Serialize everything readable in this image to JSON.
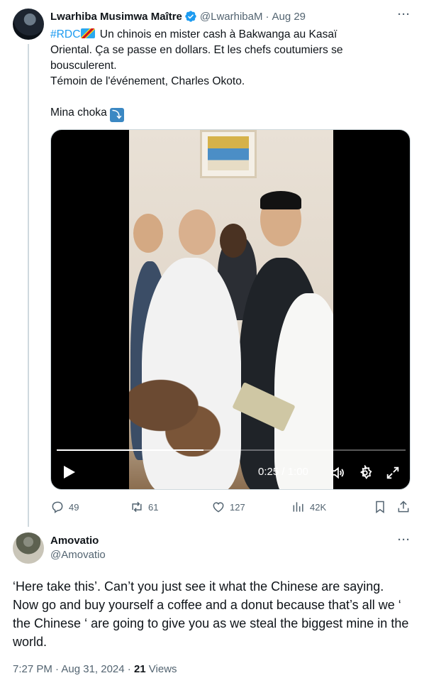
{
  "tweet": {
    "author_name": "Lwarhiba Musimwa Maître",
    "author_handle": "@LwarhibaM",
    "date": "Aug 29",
    "hashtag": "#RDC",
    "text_line1": " Un chinois en mister cash à Bakwanga au Kasaï",
    "text_line2": "Oriental. Ça se passe en dollars. Et les chefs coutumiers se",
    "text_line3": "bousculerent.",
    "text_line4": "Témoin de l'événement, Charles Okoto.",
    "text_line5": "Mina choka",
    "arrow_emoji": "⤵",
    "video": {
      "time": "0:25 / 1:00",
      "progress_fraction": 0.42
    },
    "stats": {
      "replies": "49",
      "reposts": "61",
      "likes": "127",
      "views": "42K"
    }
  },
  "reply": {
    "author_name": "Amovatio",
    "author_handle": "@Amovatio",
    "text": "‘Here take this’. Can’t you just see it what the Chinese are saying. Now go and buy yourself a coffee and a donut because that’s all we ‘ the Chinese ‘ are going to give you as we steal the biggest mine in the world.",
    "time": "7:27 PM · Aug 31, 2024 · ",
    "views_count": "21",
    "views_label": " Views"
  },
  "colors": {
    "accent": "#1d9bf0",
    "secondary_text": "#536471",
    "divider": "#cfd9de"
  },
  "icons": [
    "more-icon",
    "verified-icon",
    "flag-icon",
    "arrow-emoji-icon",
    "play-icon",
    "volume-icon",
    "settings-icon",
    "fullscreen-icon",
    "reply-icon",
    "repost-icon",
    "like-icon",
    "views-icon",
    "bookmark-icon",
    "share-icon"
  ]
}
